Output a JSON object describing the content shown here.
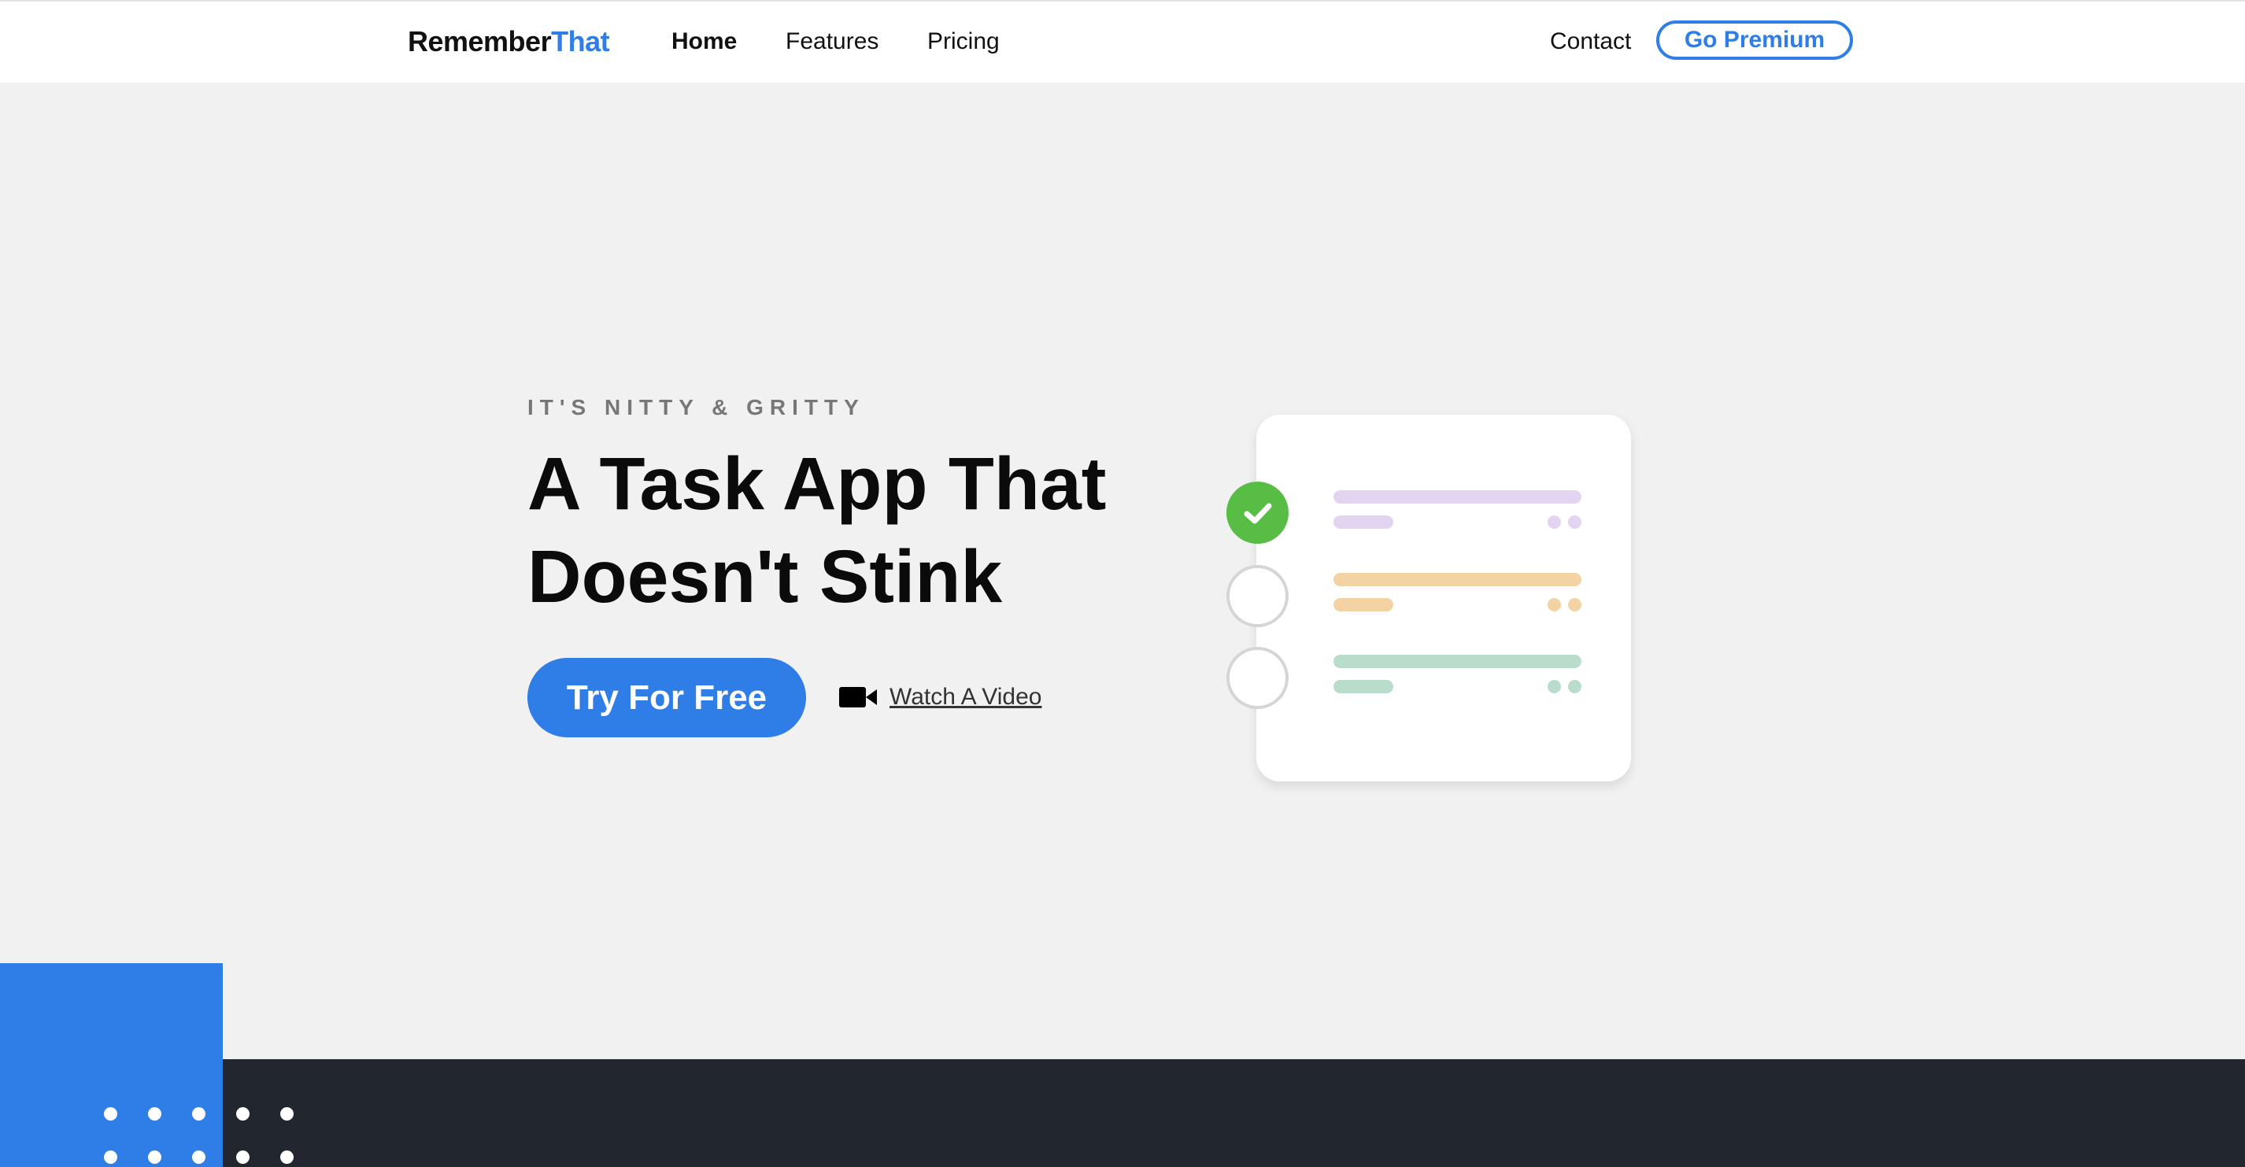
{
  "brand": {
    "name_part1": "Remember",
    "name_part2": "That",
    "accent_color": "#2f7de6"
  },
  "nav": {
    "links": [
      {
        "label": "Home",
        "active": true
      },
      {
        "label": "Features",
        "active": false
      },
      {
        "label": "Pricing",
        "active": false
      }
    ],
    "contact_label": "Contact",
    "premium_label": "Go Premium"
  },
  "hero": {
    "eyebrow": "IT'S NITTY & GRITTY",
    "headline_line1": "A Task App That",
    "headline_line2": "Doesn't Stink",
    "cta_label": "Try For Free",
    "video_link_label": "Watch A Video",
    "video_icon": "video-camera-icon"
  },
  "illustration": {
    "tasks": [
      {
        "status": "done",
        "color": "#e3d4f1"
      },
      {
        "status": "todo",
        "color": "#f3d3a4"
      },
      {
        "status": "todo",
        "color": "#b9dccb"
      }
    ],
    "check_color": "#57bd44"
  },
  "colors": {
    "footer_dark": "#22262e",
    "background": "#f1f1f1"
  }
}
